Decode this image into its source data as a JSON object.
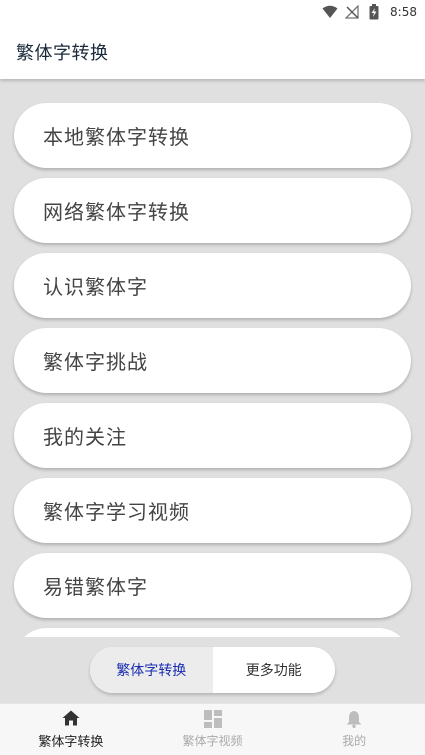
{
  "status_bar": {
    "time": "8:58",
    "icons": [
      "wifi-icon",
      "no-signal-icon",
      "battery-charging-icon"
    ]
  },
  "app_bar": {
    "title": "繁体字转换"
  },
  "menu": {
    "items": [
      {
        "label": "本地繁体字转换"
      },
      {
        "label": "网络繁体字转换"
      },
      {
        "label": "认识繁体字"
      },
      {
        "label": "繁体字挑战"
      },
      {
        "label": "我的关注"
      },
      {
        "label": "繁体字学习视频"
      },
      {
        "label": "易错繁体字"
      },
      {
        "label": ""
      }
    ]
  },
  "segmented": {
    "options": [
      {
        "label": "繁体字转换",
        "selected": true
      },
      {
        "label": "更多功能",
        "selected": false
      }
    ],
    "active_color": "#1a2cb0"
  },
  "bottom_nav": {
    "items": [
      {
        "label": "繁体字转换",
        "icon": "home-icon",
        "active": true
      },
      {
        "label": "繁体字视频",
        "icon": "dashboard-icon",
        "active": false
      },
      {
        "label": "我的",
        "icon": "bell-icon",
        "active": false
      }
    ]
  }
}
